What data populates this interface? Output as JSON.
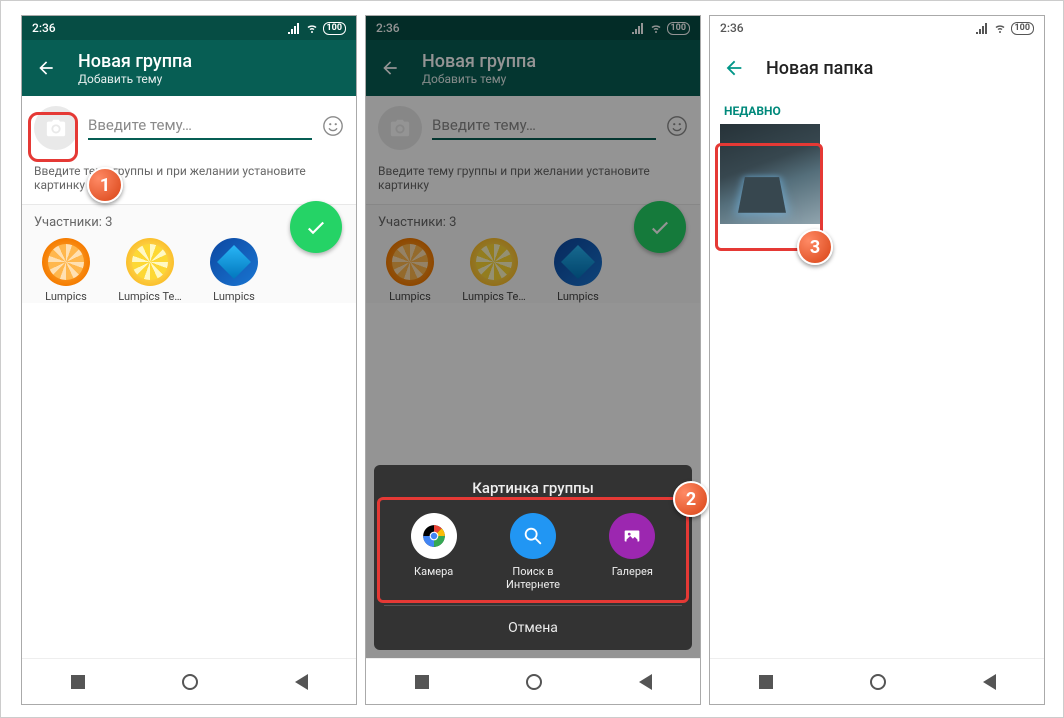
{
  "statusbar": {
    "time": "2:36",
    "battery": "100"
  },
  "header": {
    "title": "Новая группа",
    "subtitle": "Добавить тему"
  },
  "subject": {
    "placeholder": "Введите тему…"
  },
  "instruction": "Введите тему группы и при желании установите картинку",
  "participants": {
    "label": "Участники: 3",
    "items": [
      {
        "name": "Lumpics"
      },
      {
        "name": "Lumpics Te…"
      },
      {
        "name": "Lumpics"
      }
    ]
  },
  "sheet": {
    "title": "Картинка группы",
    "options": [
      {
        "label": "Камера"
      },
      {
        "label": "Поиск в Интернете"
      },
      {
        "label": "Галерея"
      }
    ],
    "cancel": "Отмена"
  },
  "phone3": {
    "title": "Новая папка",
    "section": "НЕДАВНО"
  },
  "badges": {
    "b1": "1",
    "b2": "2",
    "b3": "3"
  }
}
